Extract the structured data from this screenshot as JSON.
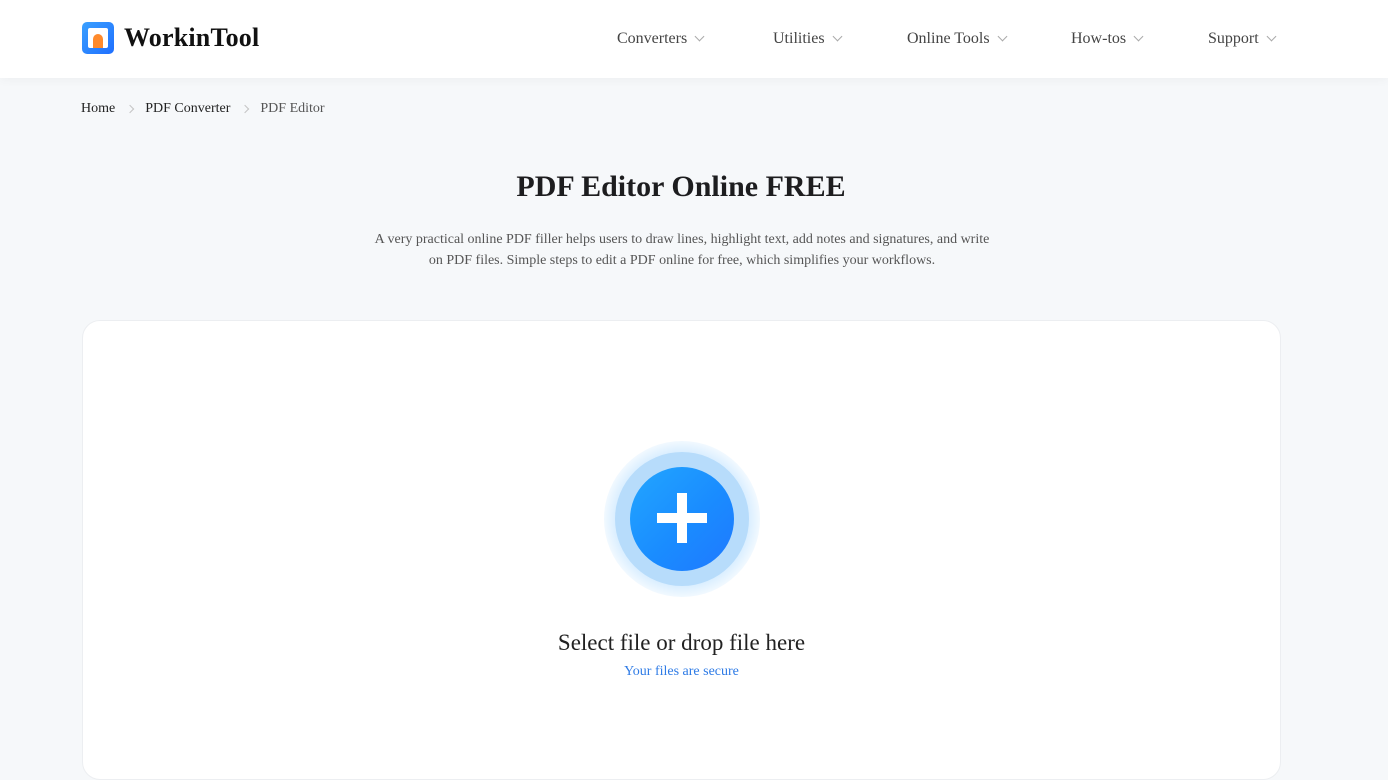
{
  "brand": {
    "name": "WorkinTool",
    "icon": "workintool-logo-icon",
    "colors": {
      "primary": "#1f78ff",
      "accent": "#ff8a2b"
    }
  },
  "nav": {
    "items": [
      {
        "label": "Converters",
        "icon": "chevron-down-icon"
      },
      {
        "label": "Utilities",
        "icon": "chevron-down-icon"
      },
      {
        "label": "Online Tools",
        "icon": "chevron-down-icon"
      },
      {
        "label": "How-tos",
        "icon": "chevron-down-icon"
      },
      {
        "label": "Support",
        "icon": "chevron-down-icon"
      }
    ]
  },
  "breadcrumb": {
    "items": [
      {
        "label": "Home"
      },
      {
        "label": "PDF Converter"
      },
      {
        "label": "PDF Editor"
      }
    ],
    "separator_icon": "chevron-right-icon"
  },
  "hero": {
    "title": "PDF Editor Online FREE",
    "description_line1": "A very practical online PDF filler helps users to draw lines, highlight text, add notes and signatures, and write",
    "description_line2": "on PDF files. Simple steps to edit a PDF online for free, which simplifies your workflows."
  },
  "upload": {
    "icon": "plus-icon",
    "prompt": "Select file or drop file here",
    "secure_note": "Your files are secure",
    "secure_color": "#2e7be6"
  }
}
